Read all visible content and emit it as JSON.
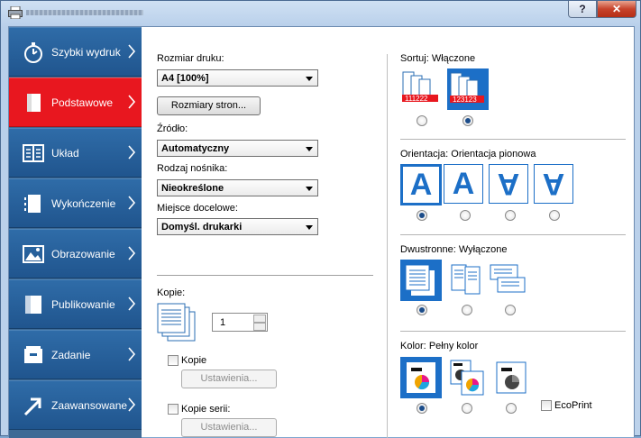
{
  "window": {
    "help": "?",
    "close": "✕"
  },
  "nav": [
    {
      "label": "Szybki wydruk",
      "icon": "stopwatch-icon",
      "active": false
    },
    {
      "label": "Podstawowe",
      "icon": "page-icon",
      "active": true
    },
    {
      "label": "Układ",
      "icon": "layout-icon",
      "active": false
    },
    {
      "label": "Wykończenie",
      "icon": "binder-icon",
      "active": false
    },
    {
      "label": "Obrazowanie",
      "icon": "image-icon",
      "active": false
    },
    {
      "label": "Publikowanie",
      "icon": "book-icon",
      "active": false
    },
    {
      "label": "Zadanie",
      "icon": "job-icon",
      "active": false
    },
    {
      "label": "Zaawansowane",
      "icon": "arrow-icon",
      "active": false
    }
  ],
  "basic": {
    "print_size_label": "Rozmiar druku:",
    "print_size_value": "A4  [100%]",
    "page_sizes_button": "Rozmiary stron...",
    "source_label": "Źródło:",
    "source_value": "Automatyczny",
    "media_label": "Rodzaj nośnika:",
    "media_value": "Nieokreślone",
    "destination_label": "Miejsce docelowe:",
    "destination_value": "Domyśl. drukarki",
    "copies_label": "Kopie:",
    "copies_value": "1",
    "copies_check_label": "Kopie",
    "copies_settings_button": "Ustawienia...",
    "series_check_label": "Kopie serii:",
    "series_settings_button": "Ustawienia..."
  },
  "collate": {
    "label": "Sortuj:",
    "value": "Włączone",
    "opt1_text": "111222",
    "opt2_text": "123123",
    "selected": 1
  },
  "orientation": {
    "label": "Orientacja:",
    "value": "Orientacja pionowa",
    "glyph": "A",
    "selected": 0
  },
  "duplex": {
    "label": "Dwustronne:",
    "value": "Wyłączone",
    "selected": 0
  },
  "color": {
    "label": "Kolor:",
    "value": "Pełny kolor",
    "selected": 0,
    "ecoprint_label": "EcoPrint"
  },
  "colors": {
    "accent": "#1c6fc7",
    "active_tab": "#e8171f",
    "nav": "#2563a0"
  }
}
